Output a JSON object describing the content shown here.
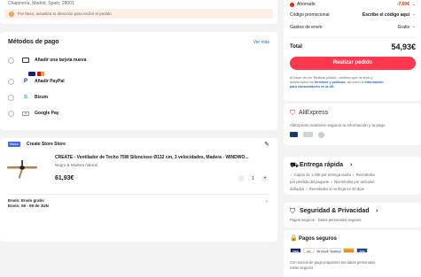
{
  "address": {
    "line": "Chapinería, Madrid, Spain, 28001",
    "warning": "Por favor, actualiza tu dirección para recibir el pedido"
  },
  "payment": {
    "title": "Métodos de pago",
    "see_more": "Ver más",
    "options": [
      {
        "label": "Añadir una tarjeta nueva"
      },
      {
        "label": "Añadir PayPal"
      },
      {
        "label": "Bizum"
      },
      {
        "label": "Google Pay"
      }
    ],
    "card_brands": [
      "VISA",
      "mastercard"
    ]
  },
  "store": {
    "badge": "Marca",
    "name": "Create Store Store",
    "product_title": "CREATE - Ventilador de Techo 75W Silencioso Ø132 cm, 3 velocidades, Madera - WINDWO...",
    "variant": "Negro & Madera natural",
    "price": "61,93€",
    "quantity": "1",
    "shipping_line1": "Envío: Envío gratis",
    "shipping_line2": "Envío: 06 - 09 de JUN"
  },
  "summary": {
    "ahorrado_label": "Ahorrado",
    "ahorrado_value": "-7,00€",
    "promo_label": "Código promocional",
    "promo_value": "Escribe el código aquí",
    "shipping_label": "Gastos de envío",
    "shipping_value": "Gratis",
    "total_label": "Total",
    "total_value": "54,93€",
    "order_button": "Realizar pedido",
    "legal_1": "Al hacer clic en 'Realizar pedido', confirmo que he leído y",
    "legal_2a": "acepto todos los ",
    "legal_2b": "términos y políticas",
    "legal_2c": ", así como la ",
    "legal_2d": "información",
    "legal_3": "para consumidores en la UE."
  },
  "aliexpress": {
    "brand": "AliExpress",
    "text": "AliExpress mantiene seguros tu información y tu pago"
  },
  "delivery": {
    "title": "Entrega rápida",
    "line1": "✓ Cupón de 1,00€ por entrega tardía  ✓ Reembolso",
    "line2": "por pérdida del paquete  ✓ Reembolso por artículos",
    "line3": "dañados  ✓ Reembolso si no llega en 20 días"
  },
  "security": {
    "title": "Seguridad & Privacidad",
    "text": "Pagos seguros · Datos personales seguros"
  },
  "secure_payments": {
    "title": "Pagos seguros",
    "badges": [
      "VISA",
      "mc",
      "ID Check",
      "SafeKey",
      "",
      "JCB"
    ],
    "text1": "Con socios de pago populares tus datos personales",
    "text2": "están seguros"
  }
}
